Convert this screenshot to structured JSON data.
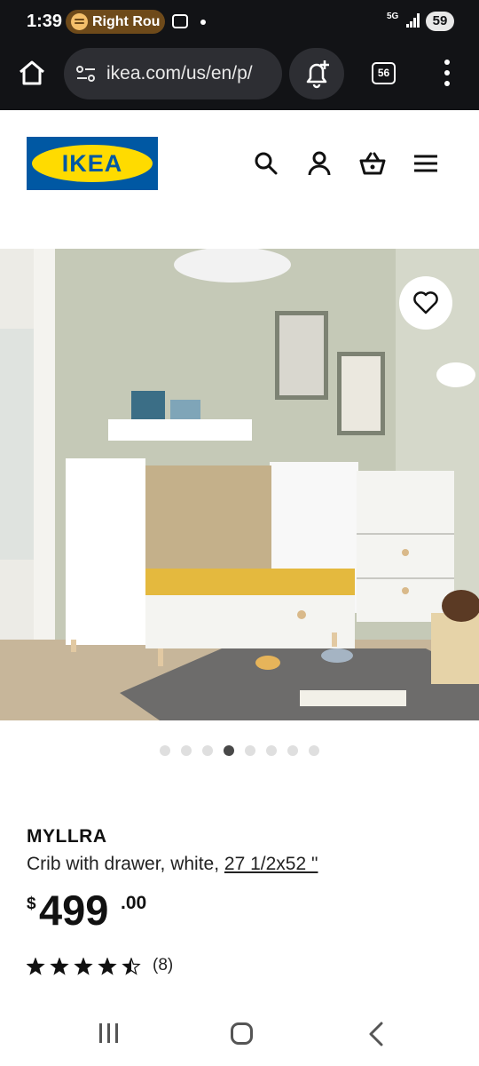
{
  "status_bar": {
    "time": "1:39",
    "now_playing": "Right Rou",
    "network": "5G",
    "battery": "59"
  },
  "browser": {
    "url": "ikea.com/us/en/p/",
    "tab_count": "56"
  },
  "header": {
    "logo_text": "IKEA",
    "brand_colors": {
      "blue": "#0058a3",
      "yellow": "#ffdb00"
    },
    "icons": [
      "search-icon",
      "account-icon",
      "shopping-bag-icon",
      "hamburger-menu-icon"
    ]
  },
  "gallery": {
    "image_count": 8,
    "active_index": 3
  },
  "product": {
    "name": "MYLLRA",
    "description": "Crib with drawer, white, ",
    "size": "27 1/2x52 \"",
    "price_currency": "$",
    "price_whole": "499",
    "price_decimal": ".00",
    "rating": 4.5,
    "rating_count": "(8)"
  }
}
